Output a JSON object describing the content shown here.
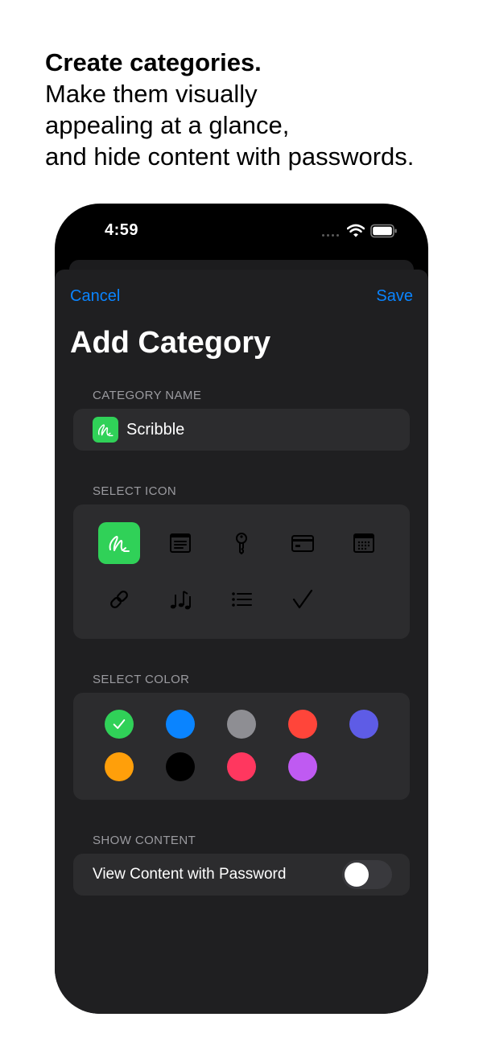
{
  "headline": {
    "bold": "Create categories.",
    "lines": [
      "Make them visually",
      "appealing at a glance,",
      "and hide content with passwords."
    ]
  },
  "status_bar": {
    "time": "4:59"
  },
  "nav": {
    "cancel": "Cancel",
    "save": "Save",
    "title": "Add Category"
  },
  "category_name": {
    "header": "CATEGORY NAME",
    "value": "Scribble",
    "icon": "scribble-icon"
  },
  "select_icon": {
    "header": "SELECT ICON",
    "icons": [
      "scribble-icon",
      "note-icon",
      "key-icon",
      "card-icon",
      "calendar-icon",
      "link-icon",
      "music-icon",
      "list-icon",
      "checkmark-icon"
    ],
    "selected": "scribble-icon"
  },
  "select_color": {
    "header": "SELECT COLOR",
    "colors": [
      "#30d158",
      "#0a84ff",
      "#8e8e93",
      "#ff453a",
      "#5e5ce6",
      "#ff9f0a",
      "#000000",
      "#ff375f",
      "#bf5af2"
    ],
    "selected": "#30d158"
  },
  "show_content": {
    "header": "SHOW CONTENT",
    "label": "View Content with Password",
    "enabled": false
  },
  "colors": {
    "accent": "#0a84ff",
    "background": "#1f1f21",
    "card": "#2c2c2e"
  }
}
